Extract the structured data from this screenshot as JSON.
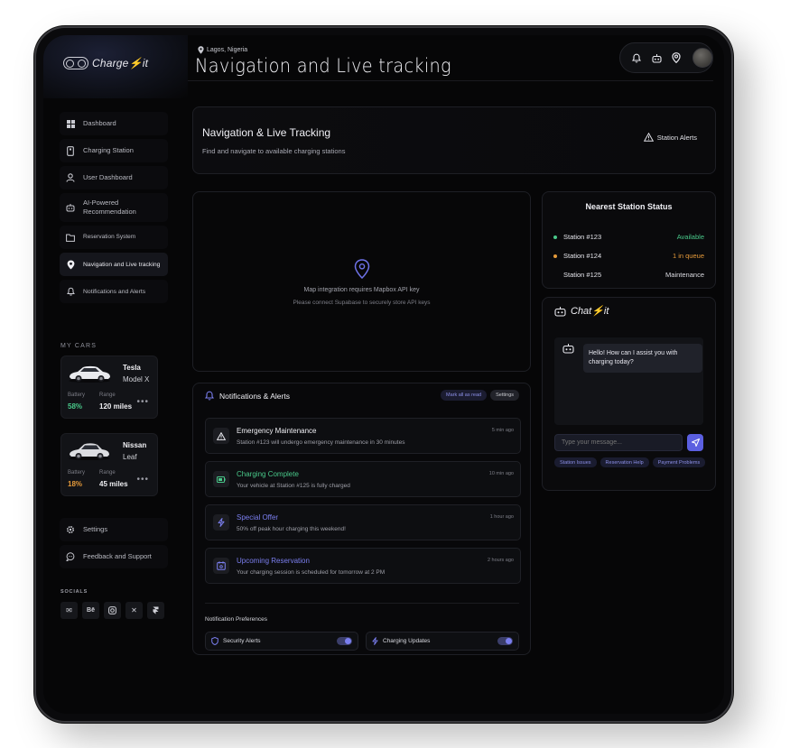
{
  "brand": {
    "name": "Charge⚡it"
  },
  "header": {
    "location": "Lagos, Nigeria",
    "title": "Navigation and Live tracking"
  },
  "sidebar": {
    "items": [
      {
        "label": "Dashboard",
        "icon": "grid-icon"
      },
      {
        "label": "Charging Station",
        "icon": "phone-icon"
      },
      {
        "label": "User Dashboard",
        "icon": "user-icon"
      },
      {
        "label": "AI-Powered Recommendation",
        "icon": "robot-icon"
      },
      {
        "label": "Reservation System",
        "icon": "folder-icon"
      },
      {
        "label": "Navigation and Live tracking",
        "icon": "location-pin-icon",
        "active": true
      },
      {
        "label": "Notifications and Alerts",
        "icon": "bell-icon"
      }
    ],
    "my_cars_title": "MY CARS",
    "cars": [
      {
        "make": "Tesla",
        "model": "Model X",
        "battery_label": "Battery",
        "battery": "58%",
        "battery_color": "#49c98a",
        "range_label": "Range",
        "range": "120 miles"
      },
      {
        "make": "Nissan",
        "model": "Leaf",
        "battery_label": "Battery",
        "battery": "18%",
        "battery_color": "#e59a3a",
        "range_label": "Range",
        "range": "45 miles"
      }
    ],
    "bottom_items": [
      {
        "label": "Settings",
        "icon": "gear-icon"
      },
      {
        "label": "Feedback and Support",
        "icon": "chat-bubble-icon"
      }
    ],
    "socials_title": "SOCIALS",
    "socials": [
      "mail-icon",
      "behance-icon",
      "instagram-icon",
      "x-icon",
      "framer-icon"
    ]
  },
  "hero": {
    "title": "Navigation & Live Tracking",
    "subtitle": "Find and navigate to available charging stations",
    "alerts_button": "Station Alerts"
  },
  "map": {
    "line1": "Map integration requires Mapbox API key",
    "line2": "Please connect Supabase to securely store API keys"
  },
  "status": {
    "title": "Nearest Station Status",
    "rows": [
      {
        "name": "Station #123",
        "status": "Available",
        "color": "#49c98a",
        "dot": true
      },
      {
        "name": "Station #124",
        "status": "1 in queue",
        "color": "#e59a3a",
        "dot": true
      },
      {
        "name": "Station #125",
        "status": "Maintenance",
        "color": "#dcdce2",
        "dot": false
      }
    ]
  },
  "chat": {
    "title": "Chat⚡it",
    "message": "Hello! How can I assist you with charging today?",
    "placeholder": "Type your message...",
    "chips": [
      "Station Issues",
      "Reservation Help",
      "Payment Problems"
    ]
  },
  "notifications": {
    "title": "Notifications & Alerts",
    "mark_all": "Mark all as read",
    "settings": "Settings",
    "items": [
      {
        "title": "Emergency Maintenance",
        "desc": "Station #123 will undergo emergency maintenance in 30 minutes",
        "time": "5 min ago",
        "color": "#f0f0f5",
        "icon": "warning-icon"
      },
      {
        "title": "Charging Complete",
        "desc": "Your vehicle at Station #125 is fully charged",
        "time": "10 min ago",
        "color": "#49c98a",
        "icon": "battery-icon"
      },
      {
        "title": "Special Offer",
        "desc": "50% off peak hour charging this weekend!",
        "time": "1 hour ago",
        "color": "#7b7ff0",
        "icon": "lightning-icon"
      },
      {
        "title": "Upcoming Reservation",
        "desc": "Your charging session is scheduled for tomorrow at 2 PM",
        "time": "2 hours ago",
        "color": "#7b7ff0",
        "icon": "calendar-icon"
      }
    ],
    "prefs_title": "Notification Preferences",
    "prefs": [
      {
        "label": "Security Alerts",
        "icon": "shield-icon",
        "on": true
      },
      {
        "label": "Charging Updates",
        "icon": "lightning-icon",
        "on": true
      }
    ]
  }
}
